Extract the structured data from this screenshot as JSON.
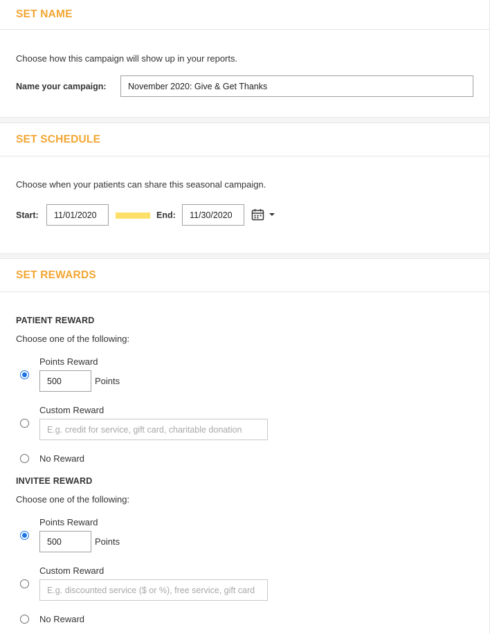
{
  "set_name": {
    "title": "SET NAME",
    "description": "Choose how this campaign will show up in your reports.",
    "name_label": "Name your campaign:",
    "name_value": "November 2020: Give & Get Thanks"
  },
  "set_schedule": {
    "title": "SET SCHEDULE",
    "description": "Choose when your patients can share this seasonal campaign.",
    "start_label": "Start:",
    "start_value": "11/01/2020",
    "end_label": "End:",
    "end_value": "11/30/2020",
    "icon": "calendar-icon"
  },
  "set_rewards": {
    "title": "SET REWARDS",
    "patient": {
      "heading": "PATIENT REWARD",
      "instruction": "Choose one of the following:",
      "points_label": "Points Reward",
      "points_value": "500",
      "points_unit": "Points",
      "custom_label": "Custom Reward",
      "custom_placeholder": "E.g. credit for service, gift card, charitable donation",
      "none_label": "No Reward",
      "selected": "points"
    },
    "invitee": {
      "heading": "INVITEE REWARD",
      "instruction": "Choose one of the following:",
      "points_label": "Points Reward",
      "points_value": "500",
      "points_unit": "Points",
      "custom_label": "Custom Reward",
      "custom_placeholder": "E.g. discounted service ($ or %), free service, gift card",
      "none_label": "No Reward",
      "selected": "points"
    }
  },
  "colors": {
    "accent": "#f2a632",
    "radio_selected": "#1a73e8",
    "range_highlight": "#fde06a"
  }
}
